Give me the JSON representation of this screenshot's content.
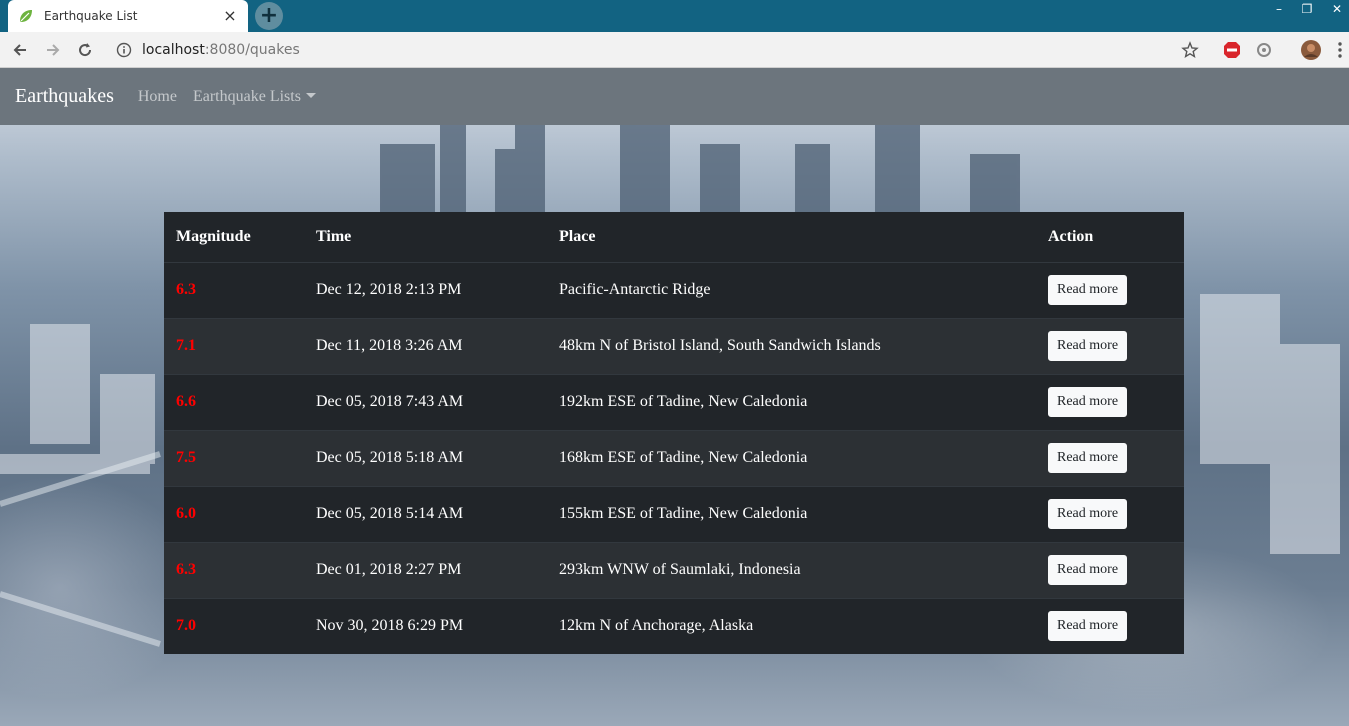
{
  "browser": {
    "tab_title": "Earthquake List",
    "tab_close": "×",
    "new_tab": "+",
    "url_host": "localhost",
    "url_rest": ":8080/quakes",
    "window_controls": [
      "–",
      "❐",
      "✕"
    ]
  },
  "navbar": {
    "brand": "Earthquakes",
    "links": [
      {
        "label": "Home"
      },
      {
        "label": "Earthquake Lists",
        "dropdown": true
      }
    ]
  },
  "table": {
    "headers": [
      "Magnitude",
      "Time",
      "Place",
      "Action"
    ],
    "rows": [
      {
        "magnitude": "6.3",
        "time": "Dec 12, 2018 2:13 PM",
        "place": "Pacific-Antarctic Ridge",
        "action": "Read more"
      },
      {
        "magnitude": "7.1",
        "time": "Dec 11, 2018 3:26 AM",
        "place": "48km N of Bristol Island, South Sandwich Islands",
        "action": "Read more"
      },
      {
        "magnitude": "6.6",
        "time": "Dec 05, 2018 7:43 AM",
        "place": "192km ESE of Tadine, New Caledonia",
        "action": "Read more"
      },
      {
        "magnitude": "7.5",
        "time": "Dec 05, 2018 5:18 AM",
        "place": "168km ESE of Tadine, New Caledonia",
        "action": "Read more"
      },
      {
        "magnitude": "6.0",
        "time": "Dec 05, 2018 5:14 AM",
        "place": "155km ESE of Tadine, New Caledonia",
        "action": "Read more"
      },
      {
        "magnitude": "6.3",
        "time": "Dec 01, 2018 2:27 PM",
        "place": "293km WNW of Saumlaki, Indonesia",
        "action": "Read more"
      },
      {
        "magnitude": "7.0",
        "time": "Nov 30, 2018 6:29 PM",
        "place": "12km N of Anchorage, Alaska",
        "action": "Read more"
      }
    ]
  },
  "colors": {
    "tabstrip": "#126382",
    "navbar": "#6c757d",
    "table_dark": "#212529",
    "magnitude": "#ff0000"
  }
}
